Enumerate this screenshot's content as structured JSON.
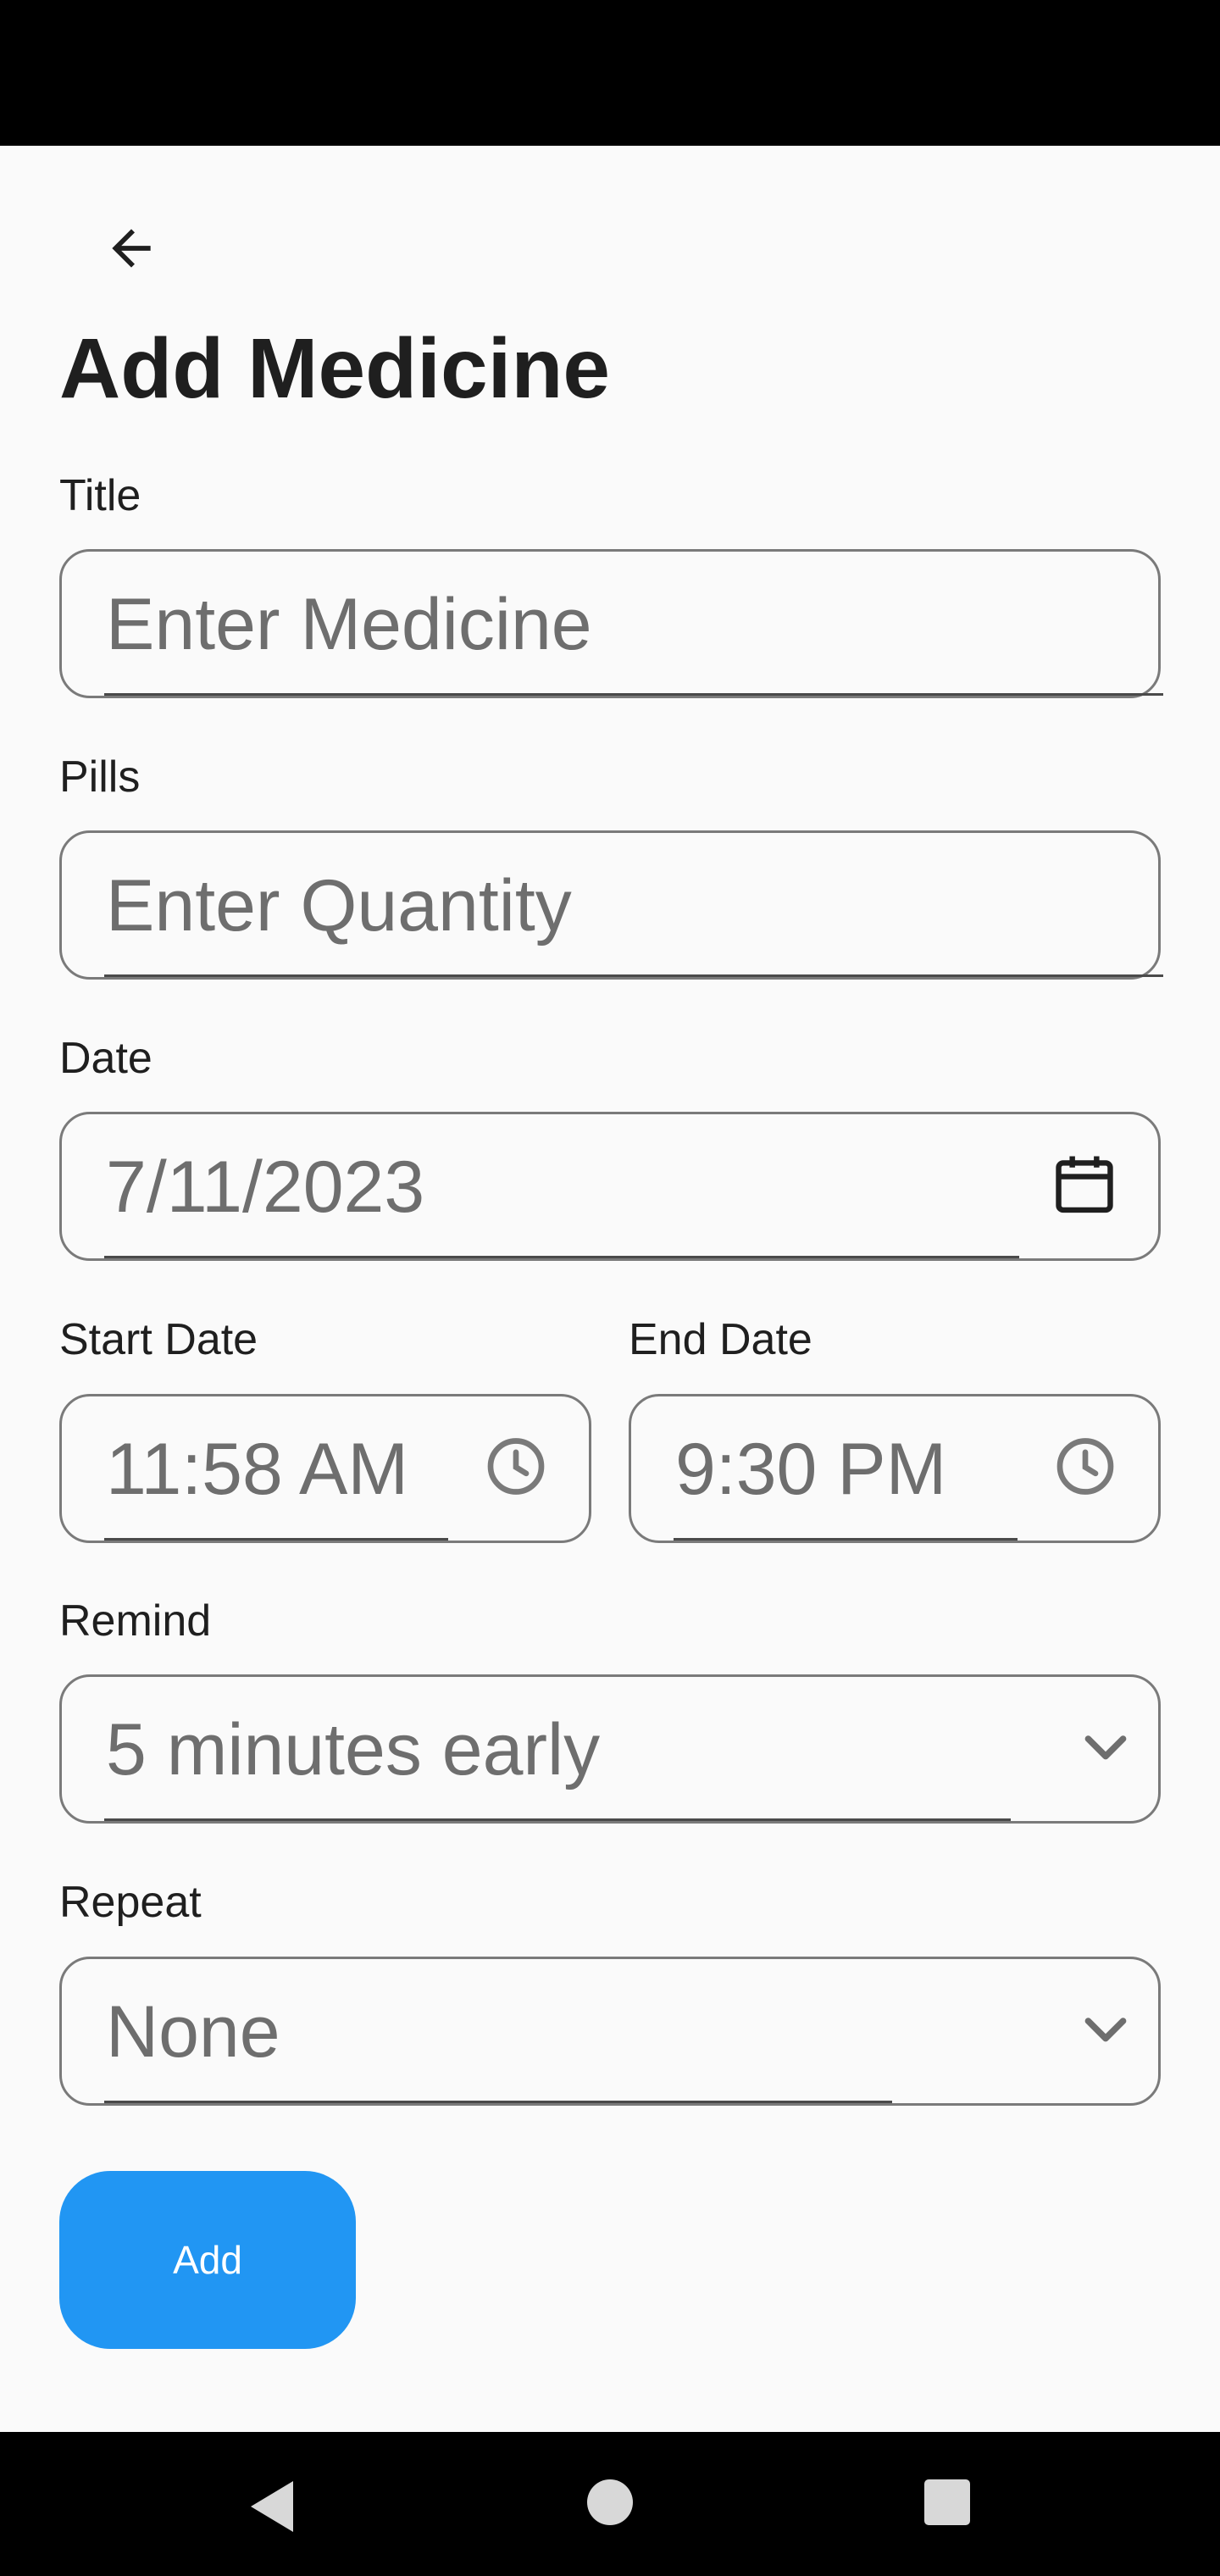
{
  "header": {
    "title": "Add Medicine"
  },
  "form": {
    "title": {
      "label": "Title",
      "placeholder": "Enter Medicine"
    },
    "pills": {
      "label": "Pills",
      "placeholder": "Enter Quantity"
    },
    "date": {
      "label": "Date",
      "value": "7/11/2023"
    },
    "start": {
      "label": "Start Date",
      "value": "11:58 AM"
    },
    "end": {
      "label": "End Date",
      "value": "9:30 PM"
    },
    "remind": {
      "label": "Remind",
      "value": "5 minutes early"
    },
    "repeat": {
      "label": "Repeat",
      "value": "None"
    }
  },
  "actions": {
    "add_label": "Add"
  },
  "colors": {
    "accent": "#2196f3",
    "background": "#fafafa",
    "border": "#7a7a7a"
  },
  "icons": [
    "arrow-left-icon",
    "calendar-icon",
    "clock-icon",
    "chevron-down-icon",
    "nav-back-icon",
    "nav-home-icon",
    "nav-recents-icon"
  ]
}
